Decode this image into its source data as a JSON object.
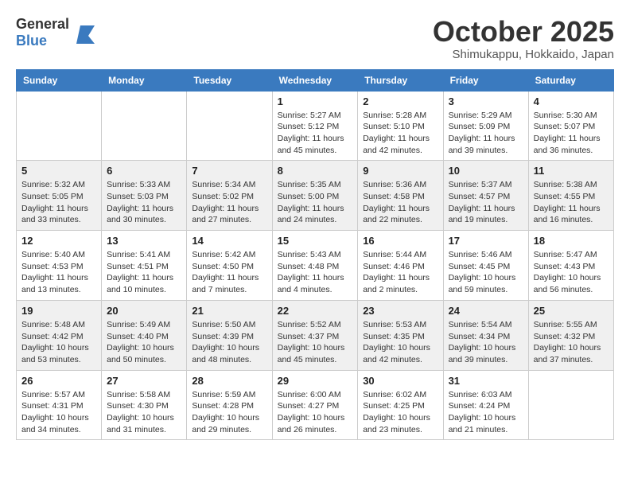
{
  "header": {
    "logo_general": "General",
    "logo_blue": "Blue",
    "month_title": "October 2025",
    "location": "Shimukappu, Hokkaido, Japan"
  },
  "weekdays": [
    "Sunday",
    "Monday",
    "Tuesday",
    "Wednesday",
    "Thursday",
    "Friday",
    "Saturday"
  ],
  "weeks": [
    [
      {
        "day": "",
        "sunrise": "",
        "sunset": "",
        "daylight": ""
      },
      {
        "day": "",
        "sunrise": "",
        "sunset": "",
        "daylight": ""
      },
      {
        "day": "",
        "sunrise": "",
        "sunset": "",
        "daylight": ""
      },
      {
        "day": "1",
        "sunrise": "Sunrise: 5:27 AM",
        "sunset": "Sunset: 5:12 PM",
        "daylight": "Daylight: 11 hours and 45 minutes."
      },
      {
        "day": "2",
        "sunrise": "Sunrise: 5:28 AM",
        "sunset": "Sunset: 5:10 PM",
        "daylight": "Daylight: 11 hours and 42 minutes."
      },
      {
        "day": "3",
        "sunrise": "Sunrise: 5:29 AM",
        "sunset": "Sunset: 5:09 PM",
        "daylight": "Daylight: 11 hours and 39 minutes."
      },
      {
        "day": "4",
        "sunrise": "Sunrise: 5:30 AM",
        "sunset": "Sunset: 5:07 PM",
        "daylight": "Daylight: 11 hours and 36 minutes."
      }
    ],
    [
      {
        "day": "5",
        "sunrise": "Sunrise: 5:32 AM",
        "sunset": "Sunset: 5:05 PM",
        "daylight": "Daylight: 11 hours and 33 minutes."
      },
      {
        "day": "6",
        "sunrise": "Sunrise: 5:33 AM",
        "sunset": "Sunset: 5:03 PM",
        "daylight": "Daylight: 11 hours and 30 minutes."
      },
      {
        "day": "7",
        "sunrise": "Sunrise: 5:34 AM",
        "sunset": "Sunset: 5:02 PM",
        "daylight": "Daylight: 11 hours and 27 minutes."
      },
      {
        "day": "8",
        "sunrise": "Sunrise: 5:35 AM",
        "sunset": "Sunset: 5:00 PM",
        "daylight": "Daylight: 11 hours and 24 minutes."
      },
      {
        "day": "9",
        "sunrise": "Sunrise: 5:36 AM",
        "sunset": "Sunset: 4:58 PM",
        "daylight": "Daylight: 11 hours and 22 minutes."
      },
      {
        "day": "10",
        "sunrise": "Sunrise: 5:37 AM",
        "sunset": "Sunset: 4:57 PM",
        "daylight": "Daylight: 11 hours and 19 minutes."
      },
      {
        "day": "11",
        "sunrise": "Sunrise: 5:38 AM",
        "sunset": "Sunset: 4:55 PM",
        "daylight": "Daylight: 11 hours and 16 minutes."
      }
    ],
    [
      {
        "day": "12",
        "sunrise": "Sunrise: 5:40 AM",
        "sunset": "Sunset: 4:53 PM",
        "daylight": "Daylight: 11 hours and 13 minutes."
      },
      {
        "day": "13",
        "sunrise": "Sunrise: 5:41 AM",
        "sunset": "Sunset: 4:51 PM",
        "daylight": "Daylight: 11 hours and 10 minutes."
      },
      {
        "day": "14",
        "sunrise": "Sunrise: 5:42 AM",
        "sunset": "Sunset: 4:50 PM",
        "daylight": "Daylight: 11 hours and 7 minutes."
      },
      {
        "day": "15",
        "sunrise": "Sunrise: 5:43 AM",
        "sunset": "Sunset: 4:48 PM",
        "daylight": "Daylight: 11 hours and 4 minutes."
      },
      {
        "day": "16",
        "sunrise": "Sunrise: 5:44 AM",
        "sunset": "Sunset: 4:46 PM",
        "daylight": "Daylight: 11 hours and 2 minutes."
      },
      {
        "day": "17",
        "sunrise": "Sunrise: 5:46 AM",
        "sunset": "Sunset: 4:45 PM",
        "daylight": "Daylight: 10 hours and 59 minutes."
      },
      {
        "day": "18",
        "sunrise": "Sunrise: 5:47 AM",
        "sunset": "Sunset: 4:43 PM",
        "daylight": "Daylight: 10 hours and 56 minutes."
      }
    ],
    [
      {
        "day": "19",
        "sunrise": "Sunrise: 5:48 AM",
        "sunset": "Sunset: 4:42 PM",
        "daylight": "Daylight: 10 hours and 53 minutes."
      },
      {
        "day": "20",
        "sunrise": "Sunrise: 5:49 AM",
        "sunset": "Sunset: 4:40 PM",
        "daylight": "Daylight: 10 hours and 50 minutes."
      },
      {
        "day": "21",
        "sunrise": "Sunrise: 5:50 AM",
        "sunset": "Sunset: 4:39 PM",
        "daylight": "Daylight: 10 hours and 48 minutes."
      },
      {
        "day": "22",
        "sunrise": "Sunrise: 5:52 AM",
        "sunset": "Sunset: 4:37 PM",
        "daylight": "Daylight: 10 hours and 45 minutes."
      },
      {
        "day": "23",
        "sunrise": "Sunrise: 5:53 AM",
        "sunset": "Sunset: 4:35 PM",
        "daylight": "Daylight: 10 hours and 42 minutes."
      },
      {
        "day": "24",
        "sunrise": "Sunrise: 5:54 AM",
        "sunset": "Sunset: 4:34 PM",
        "daylight": "Daylight: 10 hours and 39 minutes."
      },
      {
        "day": "25",
        "sunrise": "Sunrise: 5:55 AM",
        "sunset": "Sunset: 4:32 PM",
        "daylight": "Daylight: 10 hours and 37 minutes."
      }
    ],
    [
      {
        "day": "26",
        "sunrise": "Sunrise: 5:57 AM",
        "sunset": "Sunset: 4:31 PM",
        "daylight": "Daylight: 10 hours and 34 minutes."
      },
      {
        "day": "27",
        "sunrise": "Sunrise: 5:58 AM",
        "sunset": "Sunset: 4:30 PM",
        "daylight": "Daylight: 10 hours and 31 minutes."
      },
      {
        "day": "28",
        "sunrise": "Sunrise: 5:59 AM",
        "sunset": "Sunset: 4:28 PM",
        "daylight": "Daylight: 10 hours and 29 minutes."
      },
      {
        "day": "29",
        "sunrise": "Sunrise: 6:00 AM",
        "sunset": "Sunset: 4:27 PM",
        "daylight": "Daylight: 10 hours and 26 minutes."
      },
      {
        "day": "30",
        "sunrise": "Sunrise: 6:02 AM",
        "sunset": "Sunset: 4:25 PM",
        "daylight": "Daylight: 10 hours and 23 minutes."
      },
      {
        "day": "31",
        "sunrise": "Sunrise: 6:03 AM",
        "sunset": "Sunset: 4:24 PM",
        "daylight": "Daylight: 10 hours and 21 minutes."
      },
      {
        "day": "",
        "sunrise": "",
        "sunset": "",
        "daylight": ""
      }
    ]
  ]
}
